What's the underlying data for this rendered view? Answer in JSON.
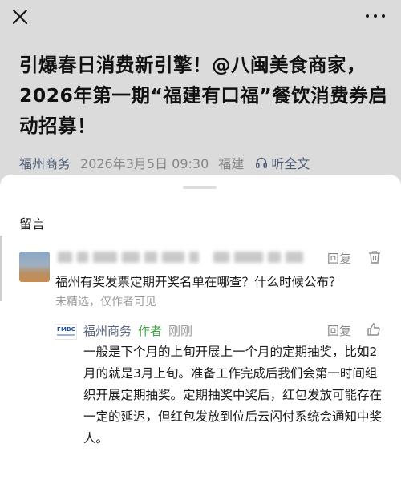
{
  "article": {
    "title": "引爆春日消费新引擎！@八闽美食商家，2026年第一期“福建有口福”餐饮消费券启动招募！",
    "source": "福州商务",
    "date": "2026年3月5日 09:30",
    "location": "福建",
    "listen_label": "听全文"
  },
  "sheet": {
    "title": "留言"
  },
  "comment": {
    "reply_label": "回复",
    "text": "福州有奖发票定期开奖名单在哪查？什么时候公布？",
    "status": "未精选，仅作者可见"
  },
  "reply": {
    "logo_text": "FMBC",
    "author": "福州商务",
    "author_tag": "作者",
    "time": "刚刚",
    "reply_label": "回复",
    "text": "一般是下个月的上旬开展上一个月的定期抽奖，比如2月的就是3月上旬。准备工作完成后我们会第一时间组织开展定期抽奖。定期抽奖中奖后，红包发放可能存在一定的延迟，但红包发放到位后云闪付系统会通知中奖人。"
  },
  "icons": {
    "close": "close-icon",
    "more": "more-icon",
    "headphones": "headphones-icon",
    "trash": "trash-icon",
    "like": "thumbs-up-icon"
  }
}
